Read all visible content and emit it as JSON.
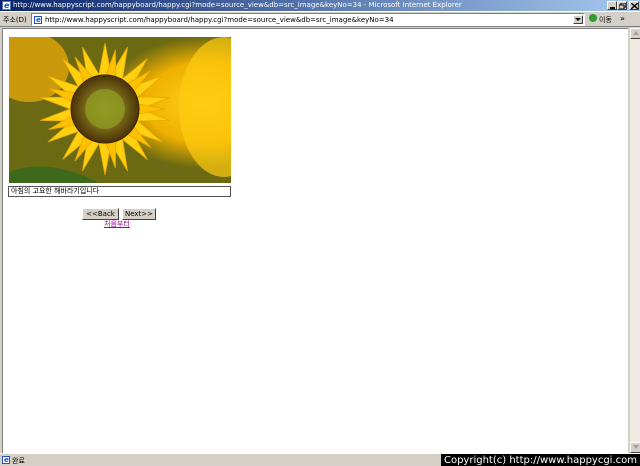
{
  "window": {
    "title": "http://www.happyscript.com/happyboard/happy.cgi?mode=source_view&db=src_image&keyNo=34 - Microsoft Internet Explorer"
  },
  "addressbar": {
    "label": "주소(D)",
    "url": "http://www.happyscript.com/happyboard/happy.cgi?mode=source_view&db=src_image&keyNo=34",
    "go_label": "이동",
    "more": "»"
  },
  "content": {
    "caption": "아침의 고요한 해바라기입니다",
    "back_label": "<<Back",
    "next_label": "Next>>",
    "first_link": "처음부터"
  },
  "statusbar": {
    "status_text": "완료",
    "watermark": "Copyright(c) http://www.happycgi.com"
  },
  "colors": {
    "titlebar_start": "#0a246a",
    "titlebar_end": "#a6caf0",
    "visited_link": "#a000a0"
  }
}
